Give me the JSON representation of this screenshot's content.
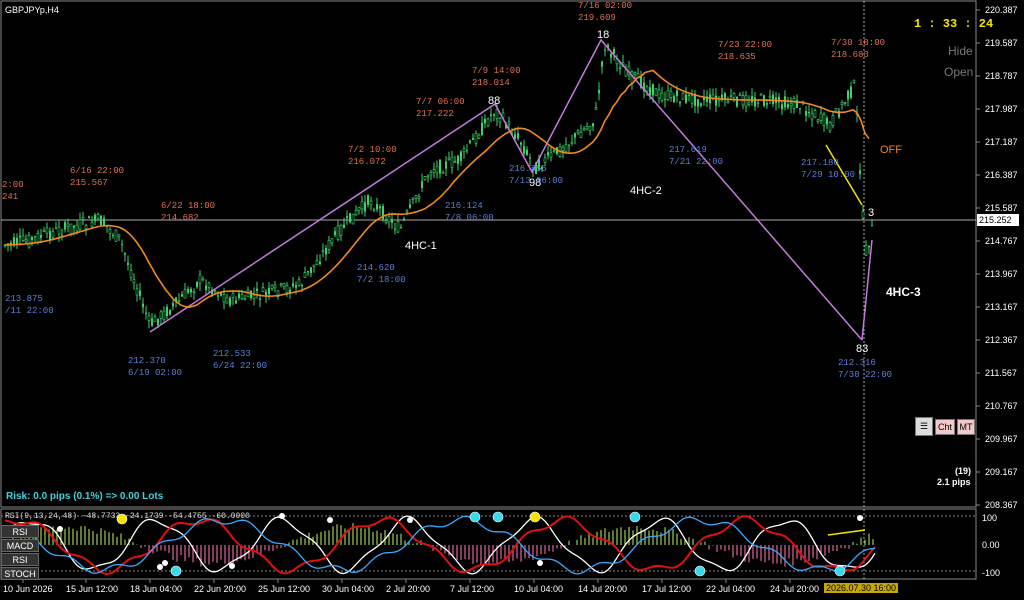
{
  "symbol_title": "GBPJPYp,H4",
  "timer": "1 : 33 : 24",
  "panel_labels": {
    "hide": "Hide",
    "open": "Open"
  },
  "off_label": "OFF",
  "risk_text": "Risk: 0.0 pips (0.1%) => 0.00 Lots",
  "pips_count": "(19)",
  "pips_value": "2.1 pips",
  "current_price": "215.252",
  "price_axis": [
    "220.387",
    "219.587",
    "218.787",
    "217.987",
    "217.187",
    "216.387",
    "215.587",
    "214.767",
    "213.967",
    "213.167",
    "212.367",
    "211.567",
    "210.767",
    "209.967",
    "209.167",
    "208.367"
  ],
  "time_axis": [
    "10 Jun 2026",
    "15 Jun 12:00",
    "18 Jun 04:00",
    "22 Jun 20:00",
    "25 Jun 12:00",
    "30 Jun 04:00",
    "2 Jul 20:00",
    "7 Jul 12:00",
    "10 Jul 04:00",
    "14 Jul 20:00",
    "17 Jul 12:00",
    "22 Jul 04:00",
    "24 Jul 20:00"
  ],
  "time_axis_highlight": "2026.07.30 16:00",
  "indicator_axis": [
    "100",
    "0.00",
    "-100"
  ],
  "indicator_header": "RSI(9,13,24,48) -48.7733 -24.1739 -54.4755 -60.0000",
  "indicator_buttons": [
    "RSI",
    "MACD",
    "RSI",
    "STOCH"
  ],
  "chart_buttons": [
    "Cht",
    "MT"
  ],
  "wave_labels": {
    "hc1": "4HC-1",
    "hc2": "4HC-2",
    "hc3": "4HC-3"
  },
  "swing_counts": [
    "88",
    "98",
    "18",
    "83",
    "3"
  ],
  "annotations": [
    {
      "price": "215.567",
      "time": "6/16 22:00",
      "color": "#e07050"
    },
    {
      "price": "214.682",
      "time": "6/22 18:00",
      "color": "#e07050"
    },
    {
      "price": "216.072",
      "time": "7/2 10:00",
      "color": "#e07050"
    },
    {
      "price": "217.222",
      "time": "7/7 06:00",
      "color": "#e07050"
    },
    {
      "price": "218.014",
      "time": "7/9 14:00",
      "color": "#e07050"
    },
    {
      "price": "219.609",
      "time": "7/16 02:00",
      "color": "#e07050"
    },
    {
      "price": "218.635",
      "time": "7/23 22:00",
      "color": "#e07050"
    },
    {
      "price": "218.683",
      "time": "7/30 18:00",
      "color": "#e07050"
    },
    {
      "price": "213.875",
      "time": "/11 22:00",
      "color": "#5b7fd9"
    },
    {
      "price": "212.370",
      "time": "6/19 02:00",
      "color": "#5b7fd9"
    },
    {
      "price": "212.533",
      "time": "6/24 22:00",
      "color": "#5b7fd9"
    },
    {
      "price": "214.620",
      "time": "7/2 18:00",
      "color": "#5b7fd9"
    },
    {
      "price": "216.124",
      "time": "7/8 06:00",
      "color": "#5b7fd9"
    },
    {
      "price": "216.355",
      "time": "7/13 06:00",
      "color": "#5b7fd9"
    },
    {
      "price": "217.619",
      "time": "7/21 22:00",
      "color": "#5b7fd9"
    },
    {
      "price": "217.180",
      "time": "7/29 10:00",
      "color": "#5b7fd9"
    },
    {
      "price": "212.316",
      "time": "7/30 22:00",
      "color": "#5b7fd9"
    }
  ],
  "edge_annotation": {
    "time": "2:00",
    "price": "241"
  },
  "colors": {
    "bull": "#3ed26a",
    "ma": "#f08a1e",
    "zigzag": "#c678dd",
    "yellow": "#f5e400",
    "bg": "#000000"
  }
}
